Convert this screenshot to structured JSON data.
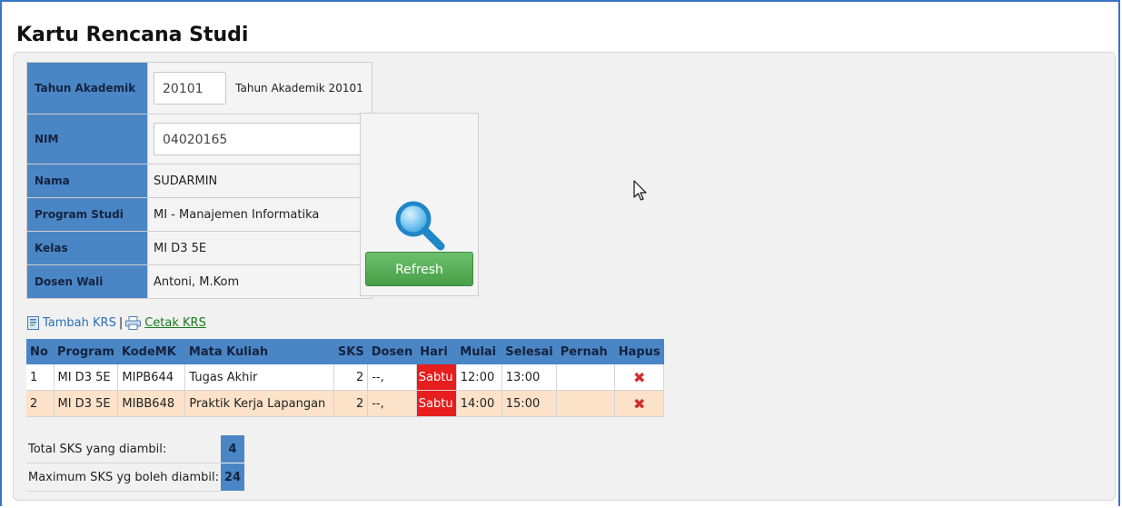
{
  "page": {
    "title": "Kartu Rencana Studi"
  },
  "info": {
    "tahun_akademik": {
      "label": "Tahun Akademik",
      "value": "20101",
      "note": "Tahun Akademik 20101"
    },
    "nim": {
      "label": "NIM",
      "value": "04020165"
    },
    "nama": {
      "label": "Nama",
      "value": "SUDARMIN"
    },
    "program_studi": {
      "label": "Program Studi",
      "value": "MI - Manajemen Informatika"
    },
    "kelas": {
      "label": "Kelas",
      "value": "MI D3 5E"
    },
    "dosen_wali": {
      "label": "Dosen Wali",
      "value": "Antoni, M.Kom"
    }
  },
  "actions": {
    "refresh_label": "Refresh",
    "tambah_label": "Tambah KRS",
    "separator": "|",
    "cetak_label": "Cetak KRS"
  },
  "krs": {
    "headers": [
      "No",
      "Program",
      "KodeMK",
      "Mata Kuliah",
      "SKS",
      "Dosen",
      "Hari",
      "Mulai",
      "Selesai",
      "Pernah",
      "Hapus"
    ],
    "rows": [
      {
        "no": "1",
        "program": "MI D3 5E",
        "kode": "MIPB644",
        "mk": "Tugas Akhir",
        "sks": "2",
        "dosen": "--,",
        "hari": "Sabtu",
        "mulai": "12:00",
        "selesai": "13:00",
        "pernah": "",
        "hapus": "✖"
      },
      {
        "no": "2",
        "program": "MI D3 5E",
        "kode": "MIBB648",
        "mk": "Praktik Kerja Lapangan",
        "sks": "2",
        "dosen": "--,",
        "hari": "Sabtu",
        "mulai": "14:00",
        "selesai": "15:00",
        "pernah": "",
        "hapus": "✖"
      }
    ]
  },
  "totals": {
    "total_label": "Total SKS yang diambil:",
    "total_value": "4",
    "max_label": "Maximum SKS yg boleh diambil:",
    "max_value": "24"
  },
  "colors": {
    "header_blue": "#4a86c5",
    "refresh_green": "#4caf50",
    "hari_red": "#e81d1d",
    "row_alt": "#fbe2c9"
  }
}
